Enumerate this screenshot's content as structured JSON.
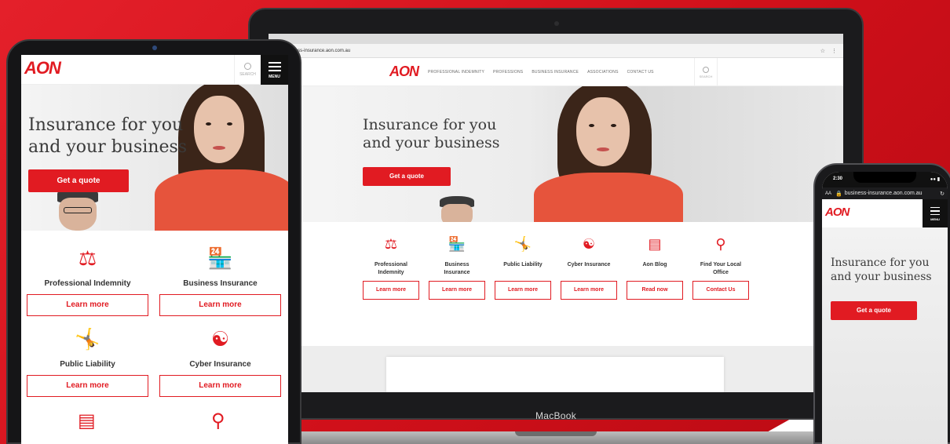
{
  "colors": {
    "brand_red": "#e11b22",
    "background_red": "#d7121c",
    "text_dark": "#333333"
  },
  "laptop": {
    "brand": "MacBook",
    "browser": {
      "url": "business-insurance.aon.com.au",
      "lock_icon": "lock-icon",
      "star_icon": "star-icon",
      "menu_icon": "more-vert-icon"
    },
    "site": {
      "logo": "AON",
      "nav": [
        "PROFESSIONAL INDEMNITY",
        "PROFESSIONS",
        "BUSINESS INSURANCE",
        "ASSOCIATIONS",
        "CONTACT US"
      ],
      "search_label": "SEARCH",
      "hero": {
        "title_line1": "Insurance for you",
        "title_line2": "and your business",
        "cta": "Get a quote"
      },
      "features": [
        {
          "icon": "gavel-document-icon",
          "label_line1": "Professional",
          "label_line2": "Indemnity",
          "button": "Learn more"
        },
        {
          "icon": "storefront-icon",
          "label_line1": "Business",
          "label_line2": "Insurance",
          "button": "Learn more"
        },
        {
          "icon": "slip-fall-icon",
          "label_line1": "Public Liability",
          "label_line2": "",
          "button": "Learn more"
        },
        {
          "icon": "circuit-icon",
          "label_line1": "Cyber Insurance",
          "label_line2": "",
          "button": "Learn more"
        },
        {
          "icon": "chat-bubble-icon",
          "label_line1": "Aon Blog",
          "label_line2": "",
          "button": "Read now"
        },
        {
          "icon": "map-pin-icon",
          "label_line1": "Find Your Local",
          "label_line2": "Office",
          "button": "Contact Us"
        }
      ]
    }
  },
  "tablet": {
    "logo": "AON",
    "search_label": "SEARCH",
    "menu_label": "MENU",
    "hero": {
      "title_line1": "Insurance for you",
      "title_line2": "and your business",
      "cta": "Get a quote"
    },
    "features": [
      {
        "icon": "gavel-document-icon",
        "label": "Professional Indemnity",
        "button": "Learn more"
      },
      {
        "icon": "storefront-icon",
        "label": "Business Insurance",
        "button": "Learn more"
      },
      {
        "icon": "slip-fall-icon",
        "label": "Public Liability",
        "button": "Learn more"
      },
      {
        "icon": "circuit-icon",
        "label": "Cyber Insurance",
        "button": "Learn more"
      }
    ]
  },
  "phone": {
    "time": "2:30",
    "url": "business-insurance.aon.com.au",
    "text_size": "AA",
    "logo": "AON",
    "menu_label": "MENU",
    "hero": {
      "title_line1": "Insurance for you",
      "title_line2": "and your business",
      "cta": "Get a quote"
    }
  }
}
